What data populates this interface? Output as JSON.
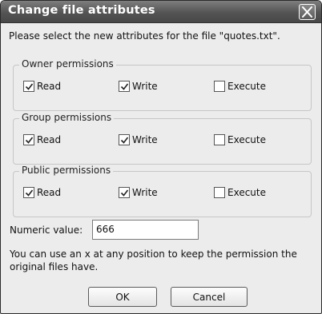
{
  "window": {
    "title": "Change file attributes",
    "prompt": "Please select the new attributes for the file \"quotes.txt\"."
  },
  "groups": [
    {
      "label": "Owner permissions",
      "read": "Read",
      "write": "Write",
      "execute": "Execute",
      "read_checked": true,
      "write_checked": true,
      "execute_checked": false
    },
    {
      "label": "Group permissions",
      "read": "Read",
      "write": "Write",
      "execute": "Execute",
      "read_checked": true,
      "write_checked": true,
      "execute_checked": false
    },
    {
      "label": "Public permissions",
      "read": "Read",
      "write": "Write",
      "execute": "Execute",
      "read_checked": true,
      "write_checked": true,
      "execute_checked": false
    }
  ],
  "numeric": {
    "label": "Numeric value:",
    "value": "666"
  },
  "hint": "You can use an x at any position to keep the permission the original files have.",
  "buttons": {
    "ok": "OK",
    "cancel": "Cancel"
  }
}
